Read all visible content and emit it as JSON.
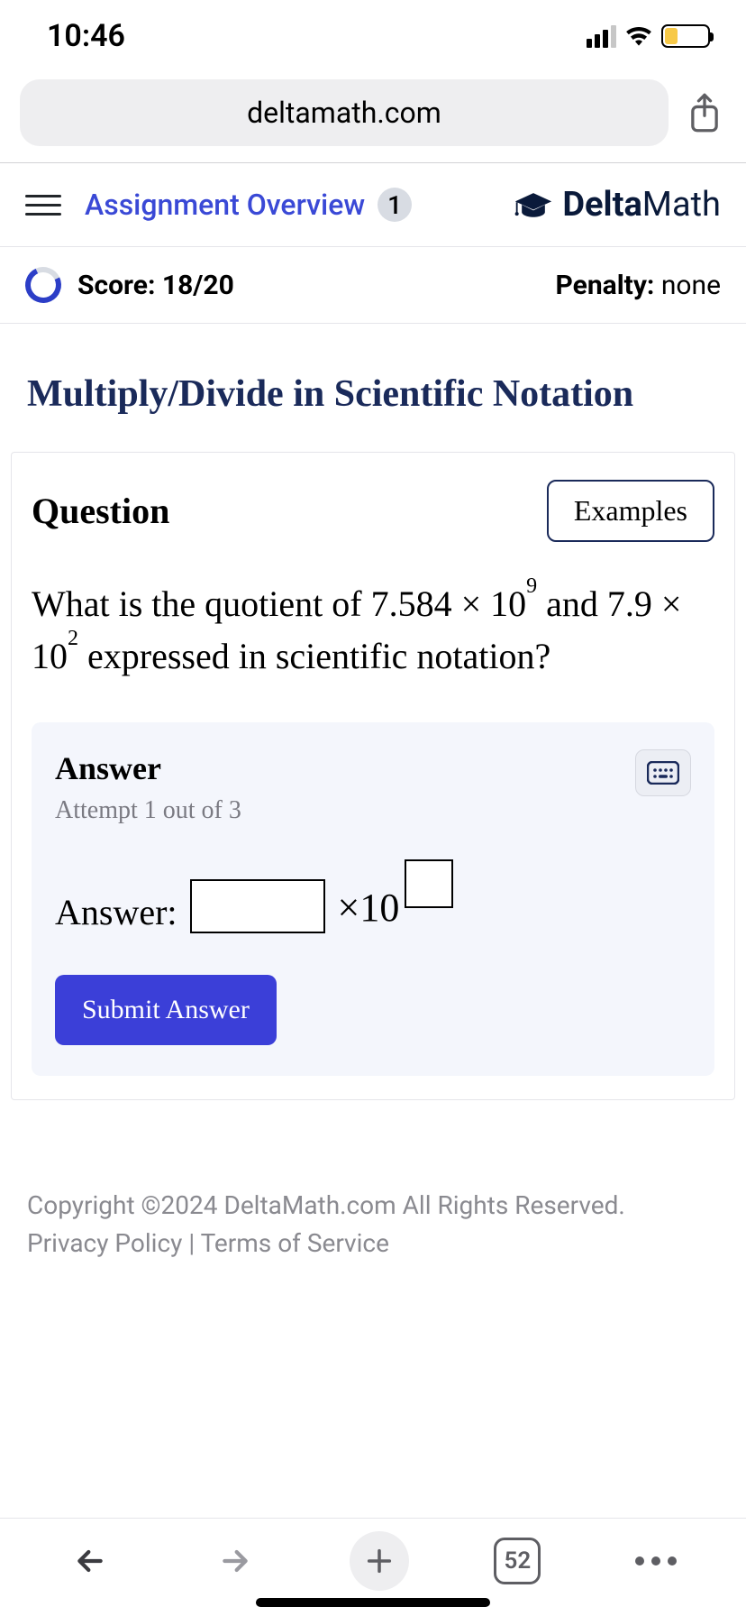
{
  "status": {
    "time": "10:46"
  },
  "browser": {
    "url": "deltamath.com",
    "tab_count": "52"
  },
  "header": {
    "overview_link": "Assignment Overview",
    "overview_badge": "1",
    "brand_prefix": "Delta",
    "brand_suffix": "Math"
  },
  "score": {
    "label": "Score:",
    "value": "18/20",
    "penalty_label": "Penalty:",
    "penalty_value": "none"
  },
  "section_title": "Multiply/Divide in Scientific Notation",
  "question": {
    "heading": "Question",
    "examples_btn": "Examples",
    "text_pre": "What is the quotient of ",
    "num1_coef": "7.584",
    "num1_exp": "9",
    "mid": " and ",
    "num2_coef": "7.9",
    "num2_exp": "2",
    "text_post": " expressed in scientific notation?"
  },
  "answer": {
    "panel_title": "Answer",
    "attempt": "Attempt 1 out of 3",
    "line_label": "Answer:",
    "times_label": "×10",
    "submit": "Submit Answer"
  },
  "legal": {
    "copyright": "Copyright ©2024 DeltaMath.com All Rights Reserved.",
    "privacy": "Privacy Policy",
    "sep": " | ",
    "terms": "Terms of Service"
  }
}
